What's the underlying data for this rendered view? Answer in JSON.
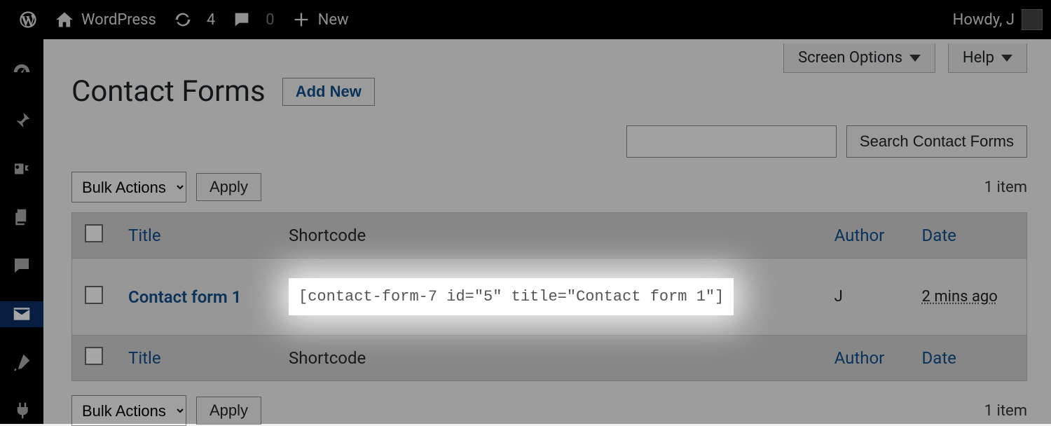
{
  "adminbar": {
    "site_name": "WordPress",
    "updates_count": "4",
    "comments_count": "0",
    "new_label": "New",
    "howdy": "Howdy, J"
  },
  "screen_meta": {
    "screen_options": "Screen Options",
    "help": "Help"
  },
  "page": {
    "title": "Contact Forms",
    "add_new": "Add New",
    "search_button": "Search Contact Forms",
    "search_value": ""
  },
  "bulk": {
    "label": "Bulk Actions",
    "apply": "Apply",
    "item_count": "1 item"
  },
  "columns": {
    "title": "Title",
    "shortcode": "Shortcode",
    "author": "Author",
    "date": "Date"
  },
  "rows": [
    {
      "title": "Contact form 1",
      "shortcode": "[contact-form-7 id=\"5\" title=\"Contact form 1\"]",
      "author": "J",
      "date": "2 mins ago"
    }
  ]
}
